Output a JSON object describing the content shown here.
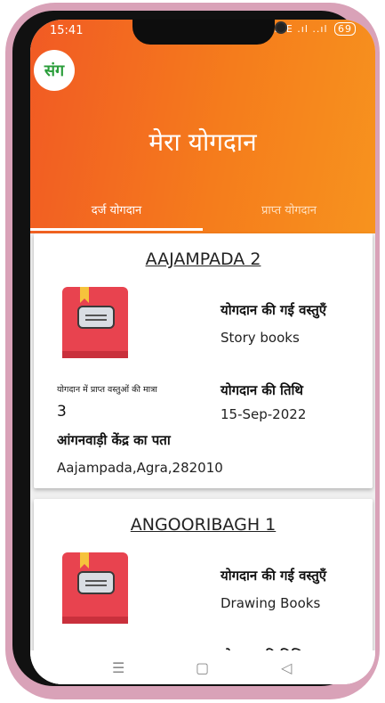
{
  "status": {
    "time": "15:41",
    "signal": "Vo LTE .ıl ..ıl",
    "battery": "69"
  },
  "app": {
    "logo_text": "संग",
    "title": "मेरा योगदान"
  },
  "tabs": [
    {
      "label": "दर्ज योगदान",
      "active": true
    },
    {
      "label": "प्राप्त योगदान",
      "active": false
    }
  ],
  "labels": {
    "items": "योगदान की गई वस्तुएँ",
    "qty": "योगदान में प्राप्त वस्तुओं की मात्रा",
    "date": "योगदान की तिथि",
    "address": "आंगनवाड़ी केंद्र का पता"
  },
  "cards": [
    {
      "title": "AAJAMPADA 2",
      "items_value": "Story books",
      "qty_value": "3",
      "date_value": "15-Sep-2022",
      "address_value": "Aajampada,Agra,282010"
    },
    {
      "title": "ANGOORIBAGH 1",
      "items_value": "Drawing Books"
    }
  ],
  "nav": {
    "menu": "☰",
    "home": "▢",
    "back": "◁"
  },
  "colors": {
    "header_start": "#f15a24",
    "header_end": "#f7931e",
    "book": "#e8434f"
  }
}
